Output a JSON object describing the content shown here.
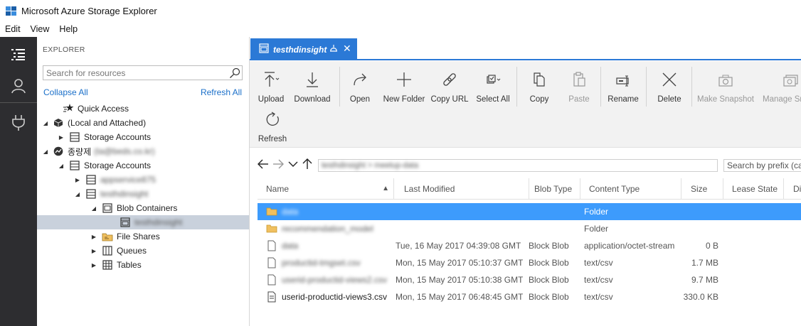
{
  "app": {
    "title": "Microsoft Azure Storage Explorer"
  },
  "menu": {
    "items": [
      "Edit",
      "View",
      "Help"
    ]
  },
  "activity": {
    "icons": [
      "explorer-icon",
      "account-icon",
      "connect-plug-icon"
    ]
  },
  "explorer": {
    "header": "EXPLORER",
    "search_placeholder": "Search for resources",
    "collapse_all": "Collapse All",
    "refresh_all": "Refresh All",
    "tree": [
      {
        "label": "Quick Access",
        "icon": "quick-access-icon",
        "expander": "",
        "depth": 0
      },
      {
        "label": "(Local and Attached)",
        "icon": "cube-icon",
        "expander": "expanded",
        "depth": 0
      },
      {
        "label": "Storage Accounts",
        "icon": "storage-accounts-icon",
        "expander": "collapsed",
        "depth": 1
      },
      {
        "label": "종량제",
        "extra": "(ta@beds.co.kr)",
        "icon": "subscription-icon",
        "expander": "expanded",
        "depth": 0
      },
      {
        "label": "Storage Accounts",
        "icon": "storage-accounts-icon",
        "expander": "expanded",
        "depth": 1
      },
      {
        "label": "appservice875",
        "icon": "storage-account-icon",
        "expander": "collapsed",
        "depth": 2,
        "blurred": true
      },
      {
        "label": "testhdinsight",
        "icon": "storage-account-icon",
        "expander": "expanded",
        "depth": 2,
        "blurred": true
      },
      {
        "label": "Blob Containers",
        "icon": "blob-containers-icon",
        "expander": "expanded",
        "depth": 3
      },
      {
        "label": "testhdinsight",
        "icon": "blob-container-icon",
        "expander": "",
        "depth": 4,
        "blurred": true,
        "selected": true
      },
      {
        "label": "File Shares",
        "icon": "file-shares-icon",
        "expander": "collapsed",
        "depth": 3
      },
      {
        "label": "Queues",
        "icon": "queues-icon",
        "expander": "collapsed",
        "depth": 3
      },
      {
        "label": "Tables",
        "icon": "tables-icon",
        "expander": "collapsed",
        "depth": 3
      }
    ]
  },
  "tab": {
    "label": "testhdinsight",
    "close": "✕"
  },
  "toolbar": {
    "buttons": [
      {
        "label": "Upload",
        "icon": "upload-icon",
        "enabled": true
      },
      {
        "label": "Download",
        "icon": "download-icon",
        "enabled": true
      },
      {
        "label": "Open",
        "icon": "open-icon",
        "enabled": true
      },
      {
        "label": "New Folder",
        "icon": "new-folder-icon",
        "enabled": true
      },
      {
        "label": "Copy URL",
        "icon": "copy-url-icon",
        "enabled": true
      },
      {
        "label": "Select All",
        "icon": "select-all-icon",
        "enabled": true
      },
      {
        "label": "Copy",
        "icon": "copy-icon",
        "enabled": true
      },
      {
        "label": "Paste",
        "icon": "paste-icon",
        "enabled": false
      },
      {
        "label": "Rename",
        "icon": "rename-icon",
        "enabled": true
      },
      {
        "label": "Delete",
        "icon": "delete-icon",
        "enabled": true
      },
      {
        "label": "Make Snapshot",
        "icon": "snapshot-icon",
        "enabled": false
      },
      {
        "label": "Manage Snapshots",
        "icon": "manage-snapshots-icon",
        "enabled": false
      },
      {
        "label": "Refresh",
        "icon": "refresh-icon",
        "enabled": true
      }
    ]
  },
  "path": {
    "text": "testhdinsight  >  meetup-data",
    "prefix_placeholder": "Search by prefix (case-sensitive)"
  },
  "grid": {
    "columns": [
      "Name",
      "Last Modified",
      "Blob Type",
      "Content Type",
      "Size",
      "Lease State",
      "Di"
    ],
    "rows": [
      {
        "name": "data",
        "modified": "",
        "blob_type": "",
        "content_type": "Folder",
        "size": "",
        "icon": "folder-icon",
        "blurred": true,
        "selected": true
      },
      {
        "name": "recommendation_model",
        "modified": "",
        "blob_type": "",
        "content_type": "Folder",
        "size": "",
        "icon": "folder-icon",
        "blurred": true
      },
      {
        "name": "data",
        "modified": "Tue, 16 May 2017 04:39:08 GMT",
        "blob_type": "Block Blob",
        "content_type": "application/octet-stream",
        "size": "0 B",
        "icon": "file-icon",
        "blurred": true
      },
      {
        "name": "productid-tmgset.csv",
        "modified": "Mon, 15 May 2017 05:10:37 GMT",
        "blob_type": "Block Blob",
        "content_type": "text/csv",
        "size": "1.7 MB",
        "icon": "file-icon",
        "blurred": true
      },
      {
        "name": "userid-productid-views2.csv",
        "modified": "Mon, 15 May 2017 05:10:38 GMT",
        "blob_type": "Block Blob",
        "content_type": "text/csv",
        "size": "9.7 MB",
        "icon": "file-icon",
        "blurred": true
      },
      {
        "name": "userid-productid-views3.csv",
        "modified": "Mon, 15 May 2017 06:48:45 GMT",
        "blob_type": "Block Blob",
        "content_type": "text/csv",
        "size": "330.0 KB",
        "icon": "file-icon",
        "blurred": false
      }
    ]
  },
  "colors": {
    "accent": "#2b79d6",
    "selection": "#3d9bfc",
    "tree_selection": "#c9d1dc",
    "activity_bg": "#2d2d30",
    "link": "#1a6fc9"
  }
}
